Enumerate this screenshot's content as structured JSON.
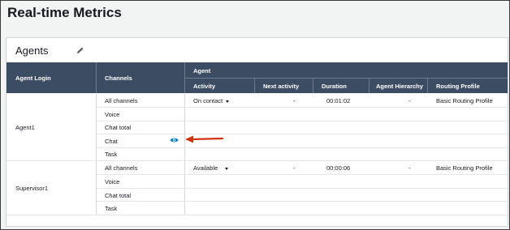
{
  "page": {
    "title": "Real-time Metrics"
  },
  "card": {
    "title": "Agents"
  },
  "table": {
    "headers": {
      "agent_login": "Agent Login",
      "channels": "Channels",
      "group": "Agent",
      "activity": "Activity",
      "next_activity": "Next activity",
      "duration": "Duration",
      "agent_hierarchy": "Agent Hierarchy",
      "routing_profile": "Routing Profile"
    },
    "agents": [
      {
        "login": "Agent1",
        "rows": [
          {
            "channel": "All channels",
            "activity": "On contact",
            "next_activity": "-",
            "duration": "00:01:02",
            "hierarchy": "-",
            "routing_profile": "Basic Routing Profile"
          },
          {
            "channel": "Voice"
          },
          {
            "channel": "Chat total"
          },
          {
            "channel": "Chat"
          },
          {
            "channel": "Task"
          }
        ]
      },
      {
        "login": "Supervisor1",
        "rows": [
          {
            "channel": "All channels",
            "activity": "Available",
            "next_activity": "-",
            "duration": "00:00:06",
            "hierarchy": "-",
            "routing_profile": "Basic Routing Profile"
          },
          {
            "channel": "Voice"
          },
          {
            "channel": "Chat total"
          },
          {
            "channel": "Task"
          }
        ]
      }
    ]
  },
  "colors": {
    "header_bg": "#3b4c63",
    "eye_icon": "#0073bb",
    "arrow": "#d13212"
  }
}
